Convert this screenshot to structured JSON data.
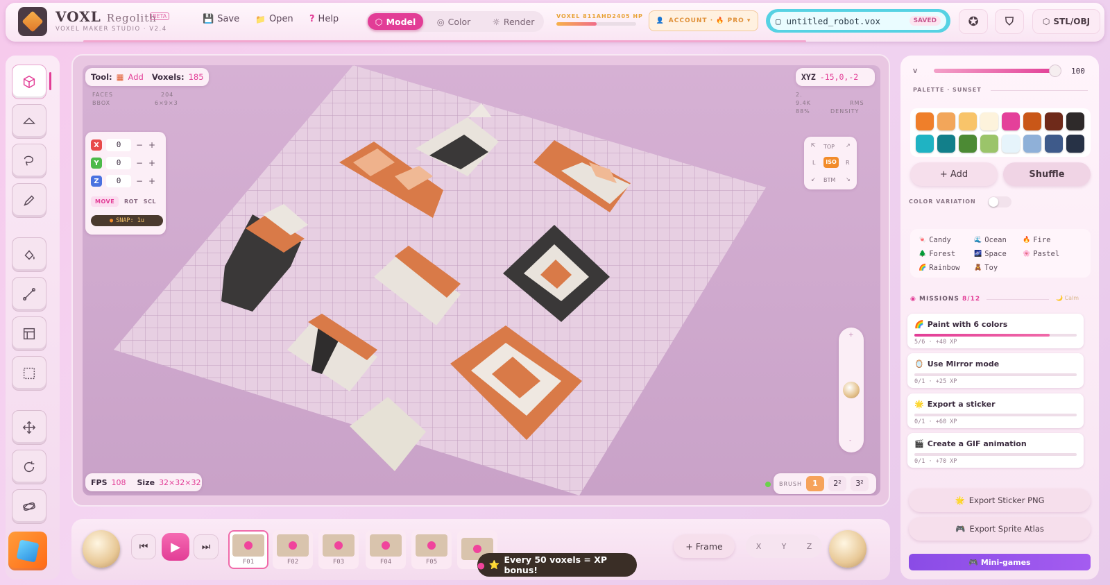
{
  "app": {
    "brand": "VOXL",
    "brand_sub": "Regolith",
    "beta": "BETA",
    "subtitle": "VOXEL MAKER STUDIO · V2.4"
  },
  "menu": {
    "save": "Save",
    "open": "Open",
    "help": "Help"
  },
  "modes": [
    {
      "label": "Model",
      "active": true
    },
    {
      "label": "Color",
      "active": false
    },
    {
      "label": "Render",
      "active": false
    }
  ],
  "xp": {
    "label": "VOXEL 811AHD2405 HP",
    "progress": 0.5
  },
  "account": {
    "label": "ACCOUNT · 🔥 PRO ▾"
  },
  "file": {
    "name": "untitled_robot.vox",
    "status": "SAVED"
  },
  "export_btn": "STL/OBJ",
  "viewport": {
    "tool_label": "Tool:",
    "tool_value": "Add",
    "voxels_label": "Voxels:",
    "voxels_value": "185",
    "stats": [
      {
        "k": "FACES",
        "v": "204"
      },
      {
        "k": "BBOX",
        "v": "6×9×3"
      }
    ],
    "xyz_label": "XYZ",
    "xyz_value": "-15,0,-2",
    "stats_right": [
      {
        "v": "2.",
        "k": ""
      },
      {
        "v": "9.4K",
        "k": "RMS"
      },
      {
        "v": "88%",
        "k": "DENSITY"
      }
    ],
    "axes": [
      {
        "name": "X",
        "color": "#e84a4a",
        "value": "0"
      },
      {
        "name": "Y",
        "color": "#4cba4a",
        "value": "0"
      },
      {
        "name": "Z",
        "color": "#4a72e0",
        "value": "0"
      }
    ],
    "transform": [
      "MOVE",
      "ROT",
      "SCL"
    ],
    "snap": "SNAP: 1u",
    "views": {
      "top": "TOP",
      "l": "L",
      "iso": "ISO",
      "r": "R",
      "btm": "BTM"
    },
    "fps_label": "FPS",
    "fps_value": "108",
    "size_label": "Size",
    "size_value": "32×32×32",
    "brush_label": "BRUSH",
    "brush_sizes": [
      "1",
      "2²",
      "3²"
    ]
  },
  "right": {
    "v_label": "V",
    "v_value": "100",
    "palette_title": "PALETTE · SUNSET",
    "palette": [
      "#ef7f2a",
      "#f2a65a",
      "#f8c46a",
      "#fdf3dc",
      "#e4409a",
      "#c95718",
      "#6f2a1a",
      "#2e2a2a",
      "#1fb3c3",
      "#127f8a",
      "#4c8a34",
      "#9bc46a",
      "#e6f4fb",
      "#8fb0d8",
      "#3e5a8a",
      "#273246"
    ],
    "add": "+ Add",
    "shuffle": "Shuffle",
    "color_variation": "COLOR VARIATION",
    "themes": [
      {
        "icon": "🍬",
        "label": "Candy"
      },
      {
        "icon": "🌊",
        "label": "Ocean"
      },
      {
        "icon": "🔥",
        "label": "Fire"
      },
      {
        "icon": "🌲",
        "label": "Forest"
      },
      {
        "icon": "🌌",
        "label": "Space"
      },
      {
        "icon": "🌸",
        "label": "Pastel"
      },
      {
        "icon": "🌈",
        "label": "Rainbow"
      },
      {
        "icon": "🧸",
        "label": "Toy"
      }
    ],
    "missions_title": "MISSIONS",
    "missions_count": "8/12",
    "missions_tag": "🌙 Calm",
    "missions": [
      {
        "icon": "🌈",
        "title": "Paint with 6 colors",
        "status": "5/6 · +40 XP",
        "progress": 0.833
      },
      {
        "icon": "🪞",
        "title": "Use Mirror mode",
        "status": "0/1 · +25 XP",
        "progress": 0
      },
      {
        "icon": "🌟",
        "title": "Export a sticker",
        "status": "0/1 · +60 XP",
        "progress": 0
      },
      {
        "icon": "🎬",
        "title": "Create a GIF animation",
        "status": "0/1 · +70 XP",
        "progress": 0
      }
    ],
    "export_sticker": "Export Sticker PNG",
    "export_atlas": "Export Sprite Atlas",
    "minigames": "🎮 Mini-games"
  },
  "timeline": {
    "frames": [
      "F01",
      "F02",
      "F03",
      "F04",
      "F05",
      ""
    ],
    "add_frame": "+  Frame",
    "axes": [
      "X",
      "Y",
      "Z"
    ],
    "toast": "Every 50 voxels = XP bonus!"
  }
}
